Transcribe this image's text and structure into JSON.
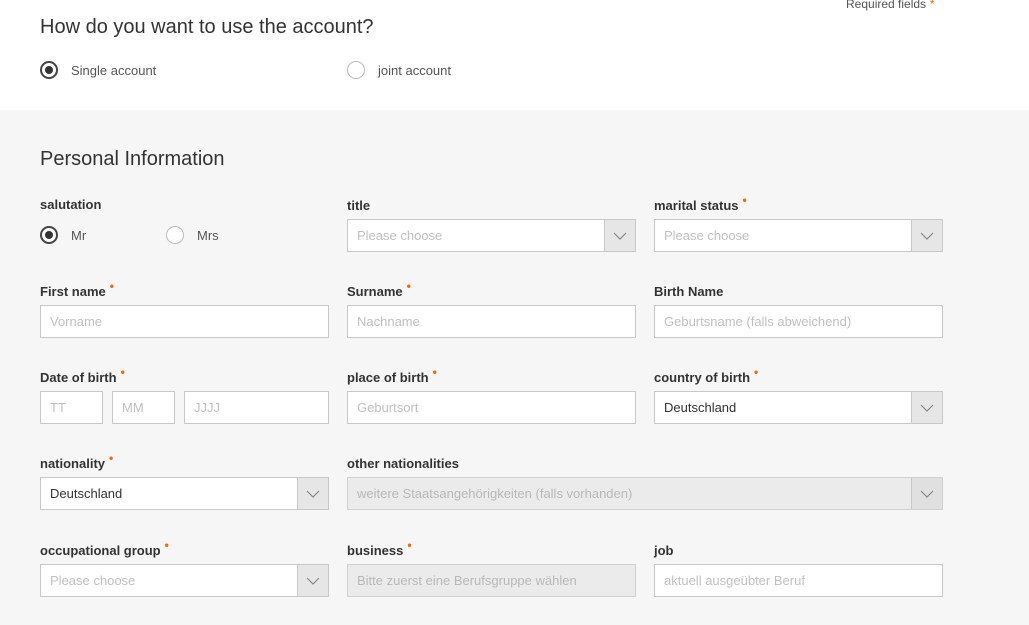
{
  "header": {
    "required_fields_label": "Required fields",
    "required_marker": "*",
    "question": "How do you want to use the account?",
    "account_options": [
      {
        "label": "Single account",
        "checked": true
      },
      {
        "label": "joint account",
        "checked": false
      }
    ]
  },
  "personal": {
    "title": "Personal Information",
    "salutation": {
      "label": "salutation",
      "options": [
        {
          "label": "Mr",
          "checked": true
        },
        {
          "label": "Mrs",
          "checked": false
        }
      ]
    },
    "title_field": {
      "label": "title",
      "placeholder": "Please choose"
    },
    "marital_status": {
      "label": "marital status",
      "placeholder": "Please choose",
      "required": "•"
    },
    "first_name": {
      "label": "First name",
      "placeholder": "Vorname",
      "required": "•"
    },
    "surname": {
      "label": "Surname",
      "placeholder": "Nachname",
      "required": "•"
    },
    "birth_name": {
      "label": "Birth Name",
      "placeholder": "Geburtsname (falls abweichend)"
    },
    "date_of_birth": {
      "label": "Date of birth",
      "day": "TT",
      "month": "MM",
      "year": "JJJJ",
      "required": "•"
    },
    "place_of_birth": {
      "label": "place of birth",
      "placeholder": "Geburtsort",
      "required": "•"
    },
    "country_of_birth": {
      "label": "country of birth",
      "value": "Deutschland",
      "required": "•"
    },
    "nationality": {
      "label": "nationality",
      "value": "Deutschland",
      "required": "•"
    },
    "other_nationalities": {
      "label": "other nationalities",
      "placeholder": "weitere Staatsangehörigkeiten (falls vorhanden)"
    },
    "occupational_group": {
      "label": "occupational group",
      "placeholder": "Please choose",
      "required": "•"
    },
    "business": {
      "label": "business",
      "placeholder": "Bitte zuerst eine Berufsgruppe wählen",
      "required": "•"
    },
    "job": {
      "label": "job",
      "placeholder": "aktuell ausgeübter Beruf"
    }
  },
  "colors": {
    "accent": "#ff6200",
    "background": "#f6f6f6",
    "field_border": "#c8c8c8"
  }
}
